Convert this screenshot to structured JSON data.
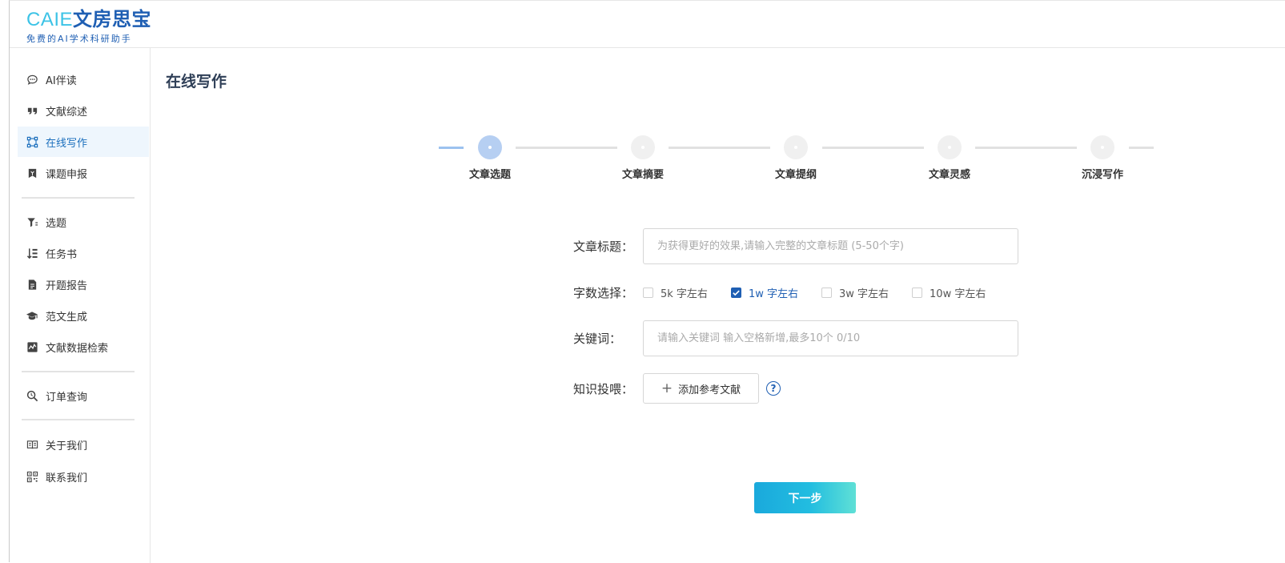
{
  "brand": {
    "logo_latin": "CAIE",
    "logo_cn": "文房思宝",
    "tagline": "免费的AI学术科研助手"
  },
  "sidebar": {
    "groups": [
      [
        {
          "label": "AI伴读",
          "icon": "chat-bubble-icon"
        },
        {
          "label": "文献综述",
          "icon": "quote-icon"
        },
        {
          "label": "在线写作",
          "icon": "flow-icon",
          "active": true
        },
        {
          "label": "课题申报",
          "icon": "bookmark-icon"
        }
      ],
      [
        {
          "label": "选题",
          "icon": "filter-icon"
        },
        {
          "label": "任务书",
          "icon": "task-list-icon"
        },
        {
          "label": "开题报告",
          "icon": "document-icon"
        },
        {
          "label": "范文生成",
          "icon": "graduation-cap-icon"
        },
        {
          "label": "文献数据检索",
          "icon": "chart-search-icon"
        }
      ],
      [
        {
          "label": "订单查询",
          "icon": "magnifier-icon"
        }
      ],
      [
        {
          "label": "关于我们",
          "icon": "book-open-icon"
        },
        {
          "label": "联系我们",
          "icon": "qr-code-icon"
        }
      ]
    ]
  },
  "main": {
    "title": "在线写作"
  },
  "steps": [
    {
      "label": "文章选题",
      "active": true
    },
    {
      "label": "文章摘要",
      "active": false
    },
    {
      "label": "文章提纲",
      "active": false
    },
    {
      "label": "文章灵感",
      "active": false
    },
    {
      "label": "沉浸写作",
      "active": false
    }
  ],
  "form": {
    "title_label": "文章标题：",
    "title_value": "",
    "title_placeholder": "为获得更好的效果,请输入完整的文章标题 (5-50个字)",
    "wordcount_label": "字数选择：",
    "wordcount_options": [
      {
        "label": "5k 字左右",
        "checked": false
      },
      {
        "label": "1w 字左右",
        "checked": true
      },
      {
        "label": "3w 字左右",
        "checked": false
      },
      {
        "label": "10w 字左右",
        "checked": false
      }
    ],
    "keywords_label": "关键词：",
    "keywords_value": "",
    "keywords_placeholder": "请输入关键词 输入空格新增,最多10个 0/10",
    "knowledge_label": "知识投喂：",
    "add_reference_label": "添加参考文献",
    "help_symbol": "?"
  },
  "actions": {
    "next_label": "下一步"
  },
  "colors": {
    "brand_blue": "#1f5fb3",
    "brand_cyan": "#3cc3e6",
    "active_bg": "#eef6fd",
    "active_step": "#b6cff2",
    "next_gradient_start": "#1aa9dc",
    "next_gradient_end": "#5fe0d6"
  }
}
